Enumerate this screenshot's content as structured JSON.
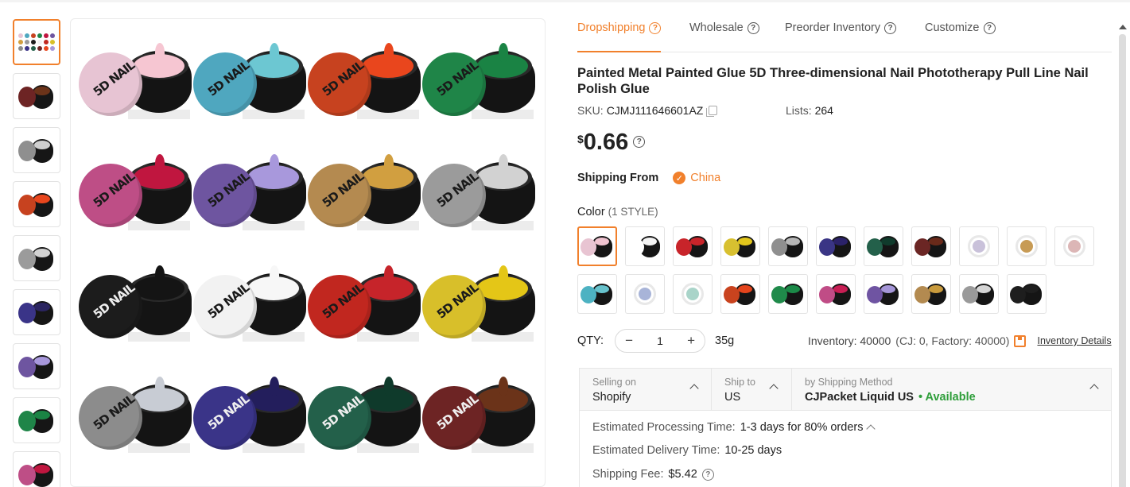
{
  "tabs": [
    {
      "label": "Dropshipping"
    },
    {
      "label": "Wholesale"
    },
    {
      "label": "Preorder Inventory"
    },
    {
      "label": "Customize"
    }
  ],
  "product": {
    "title": "Painted Metal Painted Glue 5D Three-dimensional Nail Phototherapy Pull Line Nail Polish Glue",
    "sku_label": "SKU:",
    "sku": "CJMJ111646601AZ",
    "lists_label": "Lists:",
    "lists": "264",
    "currency": "$",
    "price": "0.66"
  },
  "shipping_from": {
    "label": "Shipping From",
    "country": "China"
  },
  "color": {
    "label": "Color",
    "count": "(1 STYLE)",
    "selected_index": 0,
    "swatches": [
      {
        "name": "pink",
        "color": "#f0c3d0",
        "lid": "#e8c4d2"
      },
      {
        "name": "white",
        "color": "#f4f4f4",
        "lid": "#ffffff"
      },
      {
        "name": "red",
        "color": "#c8242a",
        "lid": "#c8242a"
      },
      {
        "name": "yellow",
        "color": "#e2c61c",
        "lid": "#d8c030"
      },
      {
        "name": "silver",
        "color": "#b7b7b7",
        "lid": "#8f8f8f"
      },
      {
        "name": "navy",
        "color": "#2b2269",
        "lid": "#3a3585"
      },
      {
        "name": "dark-green",
        "color": "#103b2c",
        "lid": "#23604a"
      },
      {
        "name": "brown",
        "color": "#6a2a1a",
        "lid": "#6b2624"
      },
      {
        "name": "lavender-dish",
        "color": "#c9c1da",
        "dish": true
      },
      {
        "name": "gold-dish",
        "color": "#c79b55",
        "dish": true
      },
      {
        "name": "rose-dish",
        "color": "#dcb6b6",
        "dish": true
      },
      {
        "name": "teal",
        "color": "#67c2cc",
        "lid": "#4db2c2"
      },
      {
        "name": "blue-dish",
        "color": "#a8b4d8",
        "dish": true
      },
      {
        "name": "mint-dish",
        "color": "#a9d4c9",
        "dish": true
      },
      {
        "name": "orange",
        "color": "#e4441c",
        "lid": "#c9431e"
      },
      {
        "name": "green",
        "color": "#1b8a48",
        "lid": "#1f8a4a"
      },
      {
        "name": "magenta",
        "color": "#c81e54",
        "lid": "#c04c86"
      },
      {
        "name": "purple",
        "color": "#a596d8",
        "lid": "#6f54a2"
      },
      {
        "name": "gold",
        "color": "#c89a3c",
        "lid": "#b38a50"
      },
      {
        "name": "silver-swirl",
        "color": "#d5d5d5",
        "lid": "#9a9a9a"
      },
      {
        "name": "black",
        "color": "#1e1e1e",
        "lid": "#1e1e1e"
      }
    ]
  },
  "qty": {
    "label": "QTY:",
    "value": "1",
    "minus": "−",
    "plus": "+",
    "weight": "35g"
  },
  "inventory": {
    "text": "Inventory: 40000",
    "detail": "(CJ: 0, Factory: 40000)",
    "link": "Inventory Details"
  },
  "shipping": {
    "selling_on_label": "Selling on",
    "selling_on": "Shopify",
    "ship_to_label": "Ship to",
    "ship_to": "US",
    "method_label": "by Shipping Method",
    "method": "CJPacket Liquid US",
    "availability": "• Available",
    "processing_label": "Estimated Processing Time:",
    "processing": "1-3 days for 80% orders",
    "delivery_label": "Estimated Delivery Time:",
    "delivery": "10-25 days",
    "fee_label": "Shipping Fee:",
    "fee": "$5.42"
  },
  "gallery": {
    "brand_text": "5D NAIL",
    "jars": [
      {
        "lid": "#e7c4d3",
        "gel": "#f6c6d2"
      },
      {
        "lid": "#4fa7bf",
        "gel": "#6cc7d2"
      },
      {
        "lid": "#c7421f",
        "gel": "#e9461d"
      },
      {
        "lid": "#1f8548",
        "gel": "#1a8344"
      },
      {
        "lid": "#be4e86",
        "gel": "#c0163f"
      },
      {
        "lid": "#6e55a0",
        "gel": "#a898dc"
      },
      {
        "lid": "#b48a50",
        "gel": "#d19f40"
      },
      {
        "lid": "#9b9b9b",
        "gel": "#d2d2d2"
      },
      {
        "lid": "#1c1c1c",
        "gel": "#141414"
      },
      {
        "lid": "#f2f2f2",
        "gel": "#f7f7f7"
      },
      {
        "lid": "#c1271f",
        "gel": "#c6242a"
      },
      {
        "lid": "#d8bf2a",
        "gel": "#e4c617"
      },
      {
        "lid": "#8c8c8c",
        "gel": "#c8ccd4"
      },
      {
        "lid": "#3a3488",
        "gel": "#231e5c"
      },
      {
        "lid": "#23604a",
        "gel": "#0f3a2b"
      },
      {
        "lid": "#6d2424",
        "gel": "#6b3319"
      }
    ],
    "thumbnails": [
      {
        "type": "grid"
      },
      {
        "lid": "#6d2424",
        "gel": "#6b3319"
      },
      {
        "lid": "#8f8f8f",
        "gel": "#cfcfcf"
      },
      {
        "lid": "#c7421f",
        "gel": "#e9461d"
      },
      {
        "lid": "#9b9b9b",
        "gel": "#d2d2d2"
      },
      {
        "lid": "#3a3488",
        "gel": "#2a2460"
      },
      {
        "lid": "#6e55a0",
        "gel": "#a898dc"
      },
      {
        "lid": "#1f8548",
        "gel": "#1a8344"
      },
      {
        "lid": "#be4e86",
        "gel": "#c0163f"
      }
    ]
  },
  "accent": "#f1802c"
}
